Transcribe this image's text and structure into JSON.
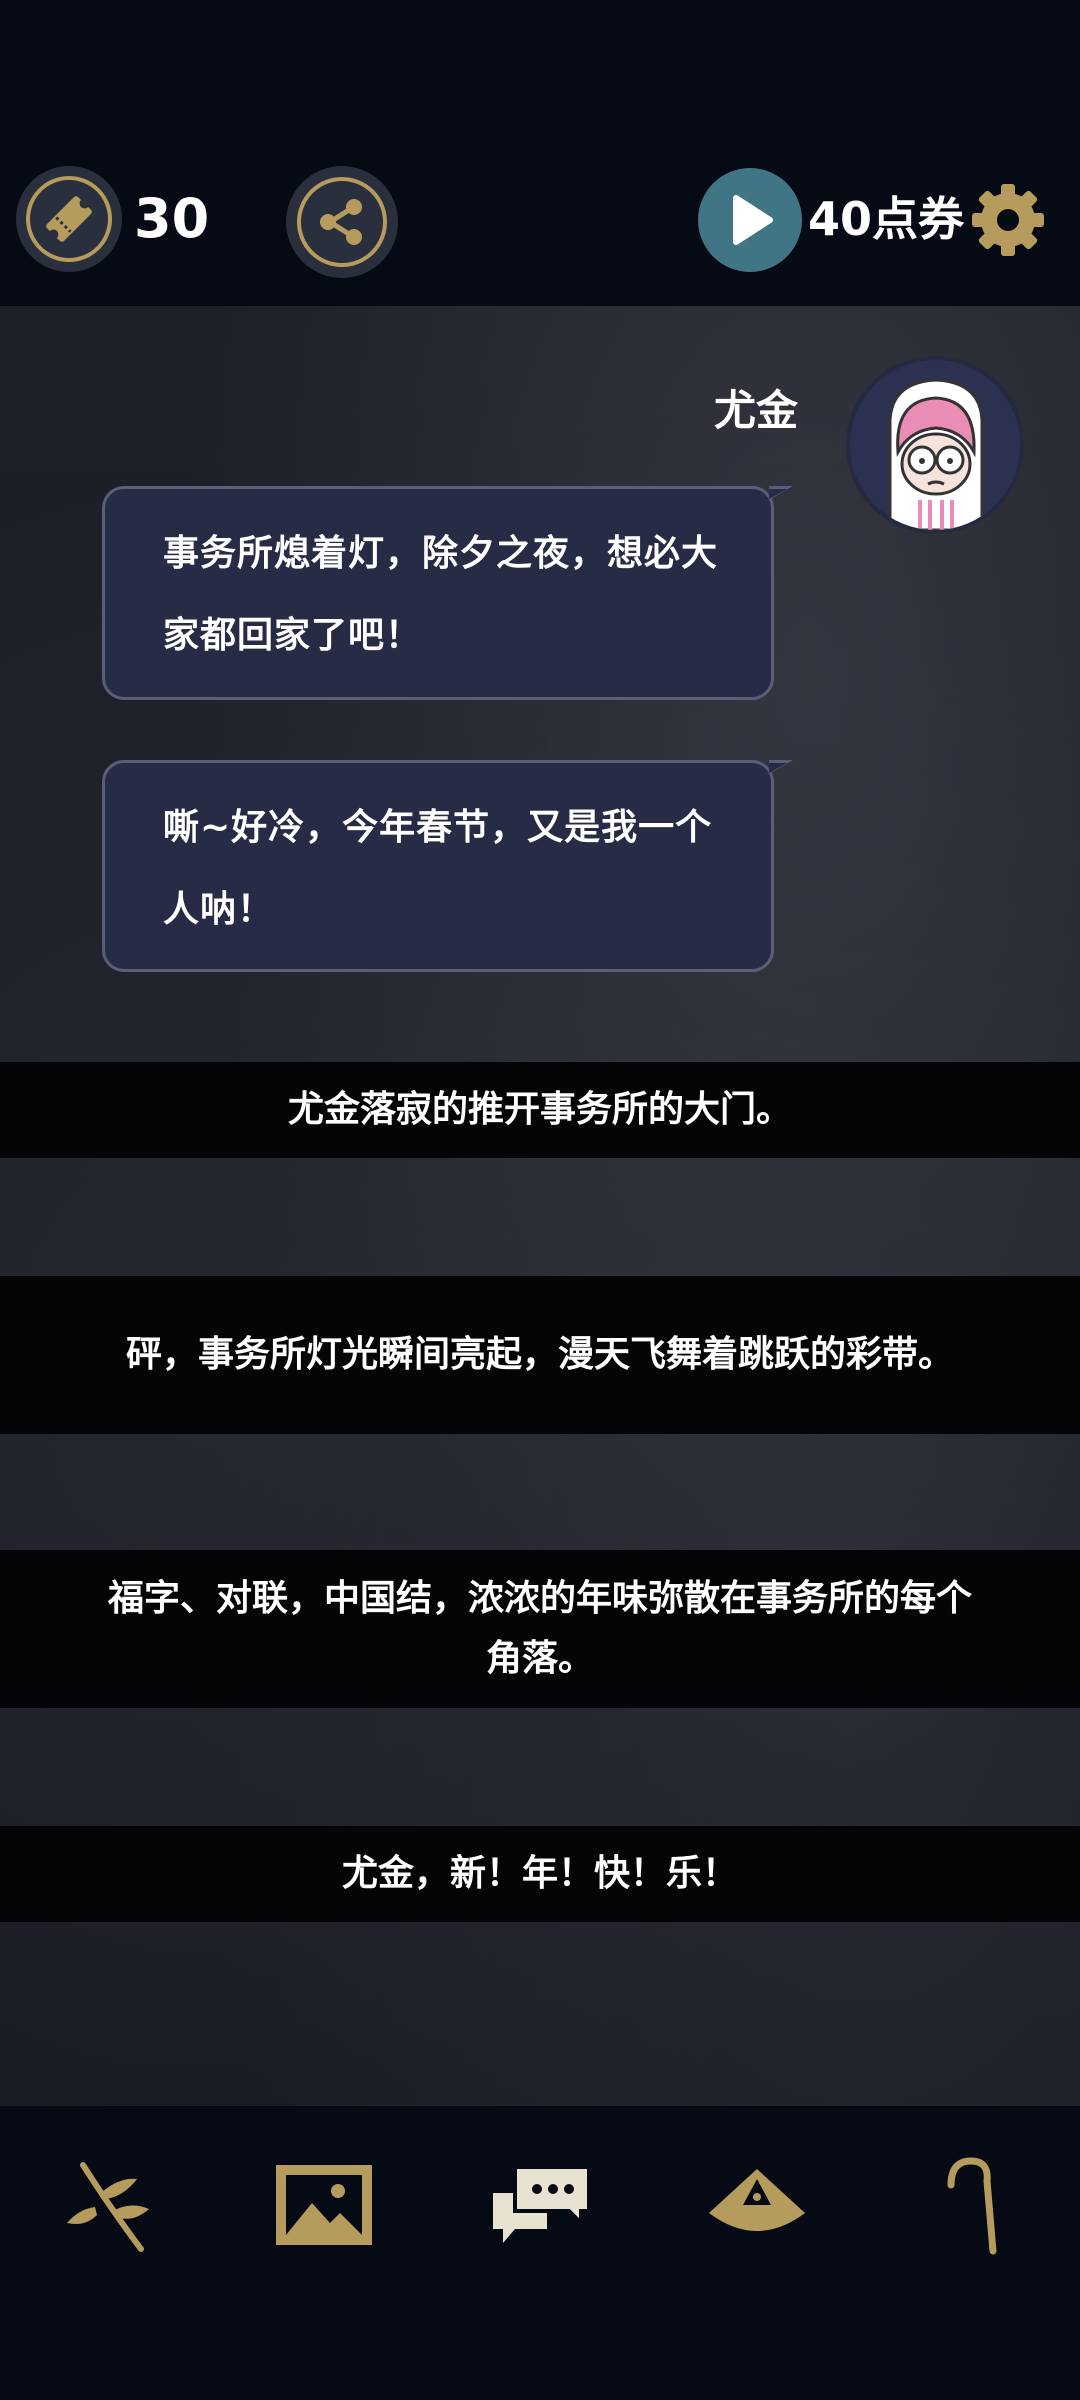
{
  "header": {
    "ticket_count": "30",
    "coupon_label": "40点券"
  },
  "dialogue": {
    "speaker": "尤金",
    "bubbles": [
      "事务所熄着灯，除夕之夜，想必大家都回家了吧！",
      "嘶~好冷，今年春节，又是我一个人呐！"
    ]
  },
  "narration": [
    "尤金落寂的推开事务所的大门。",
    "砰，事务所灯光瞬间亮起，漫天飞舞着跳跃的彩带。",
    "福字、对联，中国结，浓浓的年味弥散在事务所的每个角落。",
    "尤金，新！年！快！乐！"
  ],
  "nav": {
    "items": [
      "branch-icon",
      "gallery-icon",
      "chat-icon",
      "scale-icon",
      "cane-icon"
    ]
  },
  "colors": {
    "gold": "#b69c5c",
    "bubble_bg": "#272b45",
    "play_bg": "#3f7585",
    "background": "#060a14"
  }
}
